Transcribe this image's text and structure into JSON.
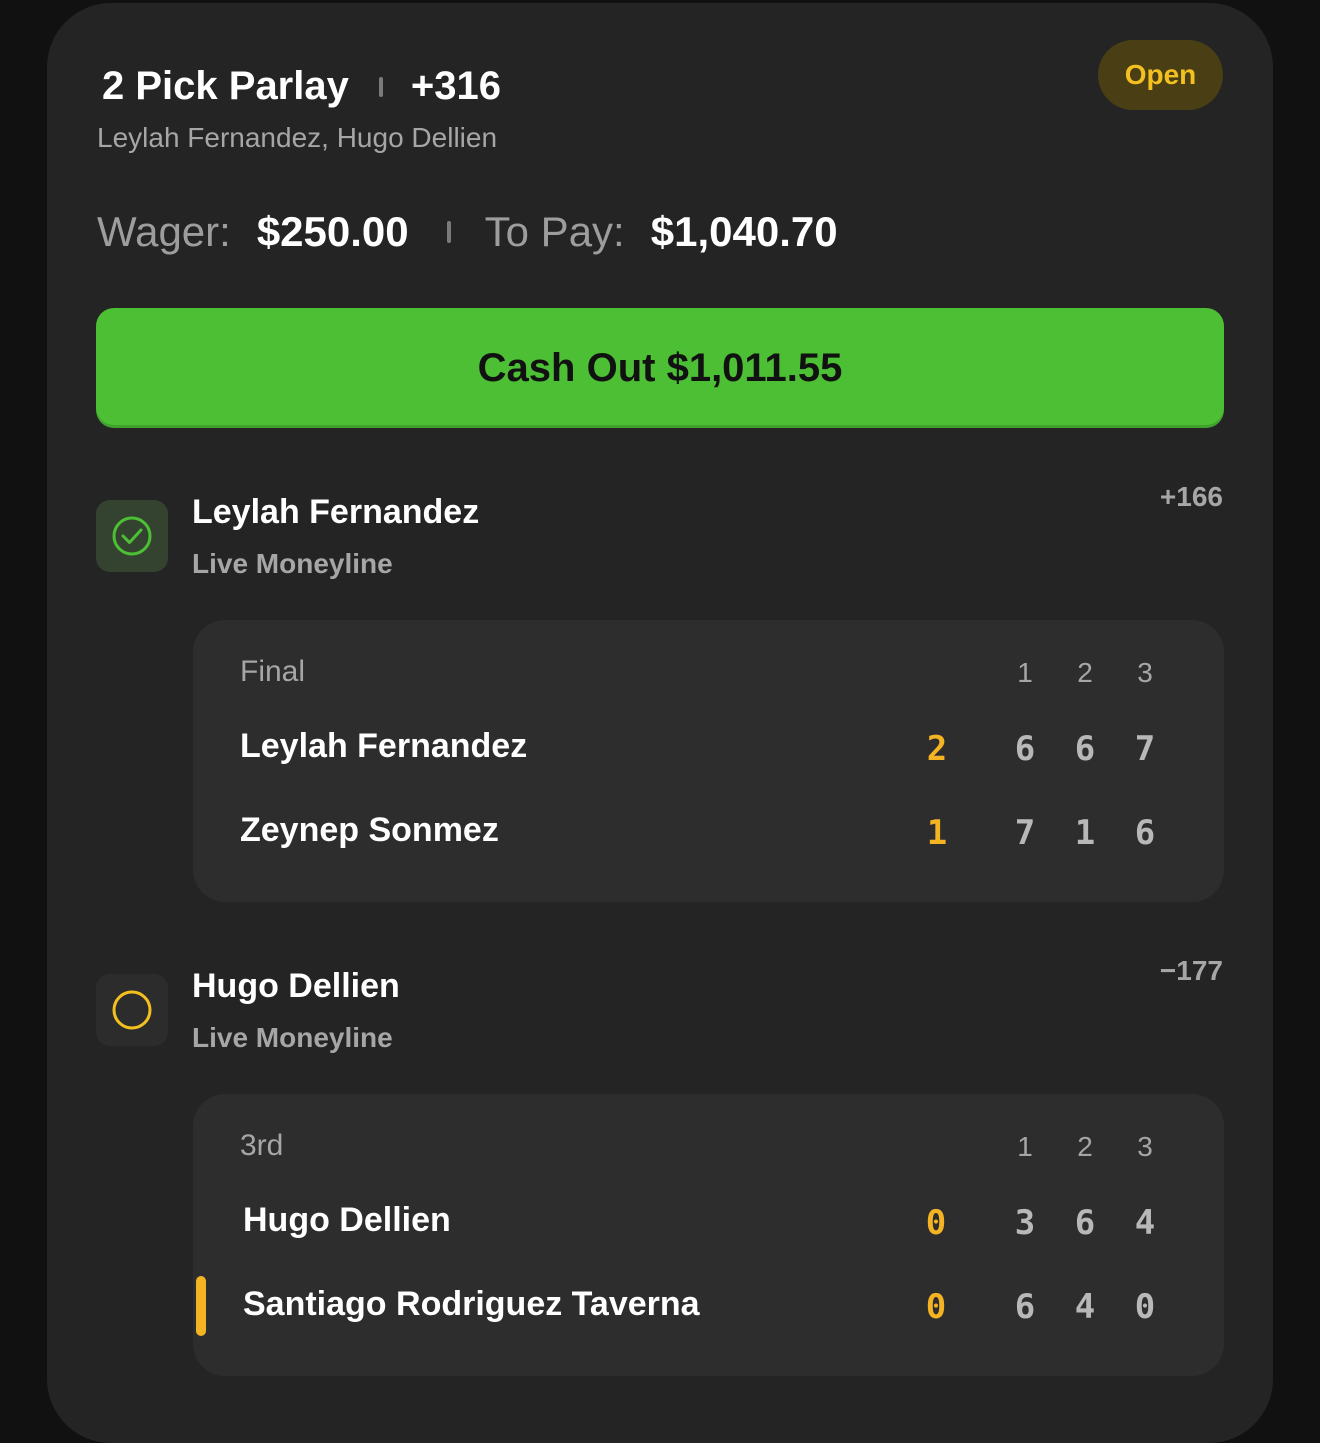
{
  "parlay": {
    "title": "2 Pick Parlay",
    "odds": "+316",
    "players": "Leylah Fernandez, Hugo Dellien",
    "status": "Open"
  },
  "wager": {
    "wager_label": "Wager:",
    "wager_value": "$250.00",
    "pay_label": "To Pay:",
    "pay_value": "$1,040.70"
  },
  "cashout": {
    "label": "Cash Out $1,011.55"
  },
  "legs": [
    {
      "selection": "Leylah Fernandez",
      "market": "Live Moneyline",
      "odds": "+166",
      "state": "won",
      "icon": "check-circle-icon",
      "score": {
        "status": "Final",
        "set_headers": [
          "1",
          "2",
          "3"
        ],
        "players": [
          {
            "name": "Leylah Fernandez",
            "sets_won": "2",
            "sets": [
              "6",
              "6",
              "7"
            ]
          },
          {
            "name": "Zeynep Sonmez",
            "sets_won": "1",
            "sets": [
              "7",
              "1",
              "6"
            ]
          }
        ]
      }
    },
    {
      "selection": "Hugo Dellien",
      "market": "Live Moneyline",
      "odds": "−177",
      "state": "pending",
      "icon": "pending-circle-icon",
      "score": {
        "status": "3rd",
        "set_headers": [
          "1",
          "2",
          "3"
        ],
        "players": [
          {
            "name": "Hugo Dellien",
            "sets_won": "0",
            "sets": [
              "3",
              "6",
              "4"
            ]
          },
          {
            "name": "Santiago Rodriguez Taverna",
            "sets_won": "0",
            "sets": [
              "6",
              "4",
              "0"
            ],
            "serving": true
          }
        ]
      }
    }
  ],
  "colors": {
    "card_bg": "#242424",
    "accent_green": "#4cbf35",
    "status_yellow": "#f4c020",
    "score_orange": "#f4b323"
  }
}
